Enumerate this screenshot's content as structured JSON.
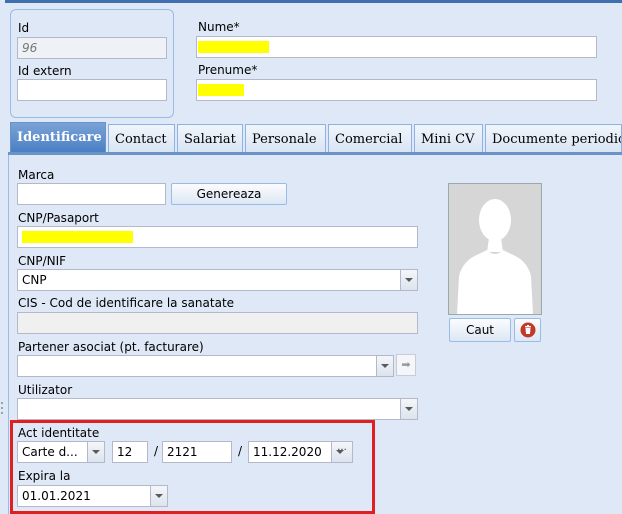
{
  "header": {
    "id_label": "Id",
    "id_value": "96",
    "id_extern_label": "Id extern",
    "id_extern_value": "",
    "nume_label": "Nume*",
    "prenume_label": "Prenume*"
  },
  "tabs": [
    {
      "label": "Identificare",
      "active": true
    },
    {
      "label": "Contact"
    },
    {
      "label": "Salariat"
    },
    {
      "label": "Personale"
    },
    {
      "label": "Comercial"
    },
    {
      "label": "Mini CV"
    },
    {
      "label": "Documente periodice"
    }
  ],
  "form": {
    "marca_label": "Marca",
    "marca_value": "",
    "genereaza_label": "Genereaza",
    "cnp_pasaport_label": "CNP/Pasaport",
    "cnp_nif_label": "CNP/NIF",
    "cnp_nif_value": "CNP",
    "cis_label": "CIS - Cod de identificare la sanatate",
    "cis_value": "",
    "partener_label": "Partener asociat (pt. facturare)",
    "partener_value": "",
    "utilizator_label": "Utilizator",
    "utilizator_value": "",
    "act_label": "Act identitate",
    "act_type": "Carte d...",
    "act_serie": "12",
    "sep1": "/",
    "act_numar": "2121",
    "sep2": "/",
    "act_data": "11.12.2020",
    "ellipsis": "···",
    "expira_label": "Expira la",
    "expira_value": "01.01.2021"
  },
  "photo": {
    "caut_label": "Caut"
  },
  "colors": {
    "accent": "#4a7fc5",
    "highlight": "#ffff00",
    "annotation": "#e02020",
    "delete": "#c0392b"
  },
  "icons": [
    "avatar-placeholder-icon",
    "trash-icon",
    "go-arrow-icon",
    "ellipsis-icon"
  ]
}
